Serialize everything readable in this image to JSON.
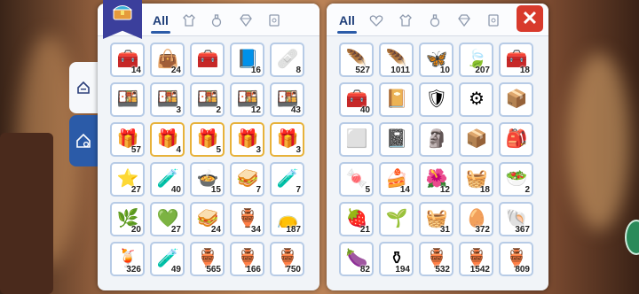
{
  "left_panel": {
    "tabs": [
      {
        "label": "All",
        "icon": "all-text",
        "active": true
      },
      {
        "label": "",
        "icon": "shirt-icon"
      },
      {
        "label": "",
        "icon": "potion-icon"
      },
      {
        "label": "",
        "icon": "gem-icon"
      },
      {
        "label": "",
        "icon": "card-icon"
      }
    ],
    "items": [
      {
        "icon": "treasure-chest-icon",
        "count": "14"
      },
      {
        "icon": "bag-icon",
        "count": "24"
      },
      {
        "icon": "treasure-chest-icon",
        "count": ""
      },
      {
        "icon": "scroll-icon",
        "count": "16"
      },
      {
        "icon": "first-aid-icon",
        "count": "8"
      },
      {
        "icon": "lunch-box-icon",
        "count": ""
      },
      {
        "icon": "lunch-box-icon",
        "count": "3"
      },
      {
        "icon": "lunch-box-icon",
        "count": "2"
      },
      {
        "icon": "lunch-box-icon",
        "count": "12"
      },
      {
        "icon": "lunch-box-icon",
        "count": "43"
      },
      {
        "icon": "gift-box-icon",
        "count": "57"
      },
      {
        "icon": "gold-chest-icon",
        "count": "4"
      },
      {
        "icon": "gold-chest-icon",
        "count": "5"
      },
      {
        "icon": "gold-chest-icon",
        "count": "3"
      },
      {
        "icon": "gold-chest-icon",
        "count": "3"
      },
      {
        "icon": "starfish-icon",
        "count": "27"
      },
      {
        "icon": "green-potion-icon",
        "count": "40"
      },
      {
        "icon": "food-plate-icon",
        "count": "15"
      },
      {
        "icon": "sandwich-icon",
        "count": "7"
      },
      {
        "icon": "red-potion-icon",
        "count": "7"
      },
      {
        "icon": "herb-icon",
        "count": "20"
      },
      {
        "icon": "heart-plate-icon",
        "count": "27"
      },
      {
        "icon": "sandwich-icon",
        "count": "24"
      },
      {
        "icon": "vase-icon",
        "count": "34"
      },
      {
        "icon": "leopard-bag-icon",
        "count": "187"
      },
      {
        "icon": "orange-potion-icon",
        "count": "326"
      },
      {
        "icon": "green-potion-icon",
        "count": "49"
      },
      {
        "icon": "jar-icon",
        "count": "565"
      },
      {
        "icon": "jar-icon",
        "count": "166"
      },
      {
        "icon": "jar-icon",
        "count": "750"
      }
    ]
  },
  "right_panel": {
    "tabs": [
      {
        "label": "All",
        "icon": "all-text",
        "active": true
      },
      {
        "label": "",
        "icon": "heart-icon"
      },
      {
        "label": "",
        "icon": "shirt-icon"
      },
      {
        "label": "",
        "icon": "potion-icon"
      },
      {
        "label": "",
        "icon": "gem-icon"
      },
      {
        "label": "",
        "icon": "card-icon"
      }
    ],
    "close_label": "✕",
    "items": [
      {
        "icon": "wing-icon",
        "count": "527"
      },
      {
        "icon": "feather-icon",
        "count": "1011"
      },
      {
        "icon": "butterfly-wing-icon",
        "count": "10"
      },
      {
        "icon": "green-leaf-icon",
        "count": "207"
      },
      {
        "icon": "treasure-chest-icon",
        "count": "18"
      },
      {
        "icon": "treasure-chest-icon",
        "count": "40"
      },
      {
        "icon": "card-album-icon",
        "count": ""
      },
      {
        "icon": "armor-icon",
        "count": ""
      },
      {
        "icon": "armor-piece-icon",
        "count": ""
      },
      {
        "icon": "equipment-box-icon",
        "count": ""
      },
      {
        "icon": "cube-icon",
        "count": ""
      },
      {
        "icon": "book-icon",
        "count": ""
      },
      {
        "icon": "statue-icon",
        "count": ""
      },
      {
        "icon": "crate-icon",
        "count": ""
      },
      {
        "icon": "backpack-icon",
        "count": ""
      },
      {
        "icon": "marshmallow-icon",
        "count": "5"
      },
      {
        "icon": "cake-icon",
        "count": "14"
      },
      {
        "icon": "flower-pot-icon",
        "count": "12"
      },
      {
        "icon": "basket-icon",
        "count": "18"
      },
      {
        "icon": "salad-icon",
        "count": "2"
      },
      {
        "icon": "fruit-plate-icon",
        "count": "21"
      },
      {
        "icon": "plant-icon",
        "count": ""
      },
      {
        "icon": "basket-icon",
        "count": "31"
      },
      {
        "icon": "egg-icon",
        "count": "372"
      },
      {
        "icon": "shell-icon",
        "count": "367"
      },
      {
        "icon": "eggplant-icon",
        "count": "82"
      },
      {
        "icon": "urn-icon",
        "count": "194"
      },
      {
        "icon": "jar-icon",
        "count": "532"
      },
      {
        "icon": "jar-icon",
        "count": "1542"
      },
      {
        "icon": "jar-icon",
        "count": "809"
      }
    ]
  },
  "side_tabs": [
    {
      "icon": "house-icon",
      "active": false
    },
    {
      "icon": "house-gear-icon",
      "active": true
    }
  ]
}
